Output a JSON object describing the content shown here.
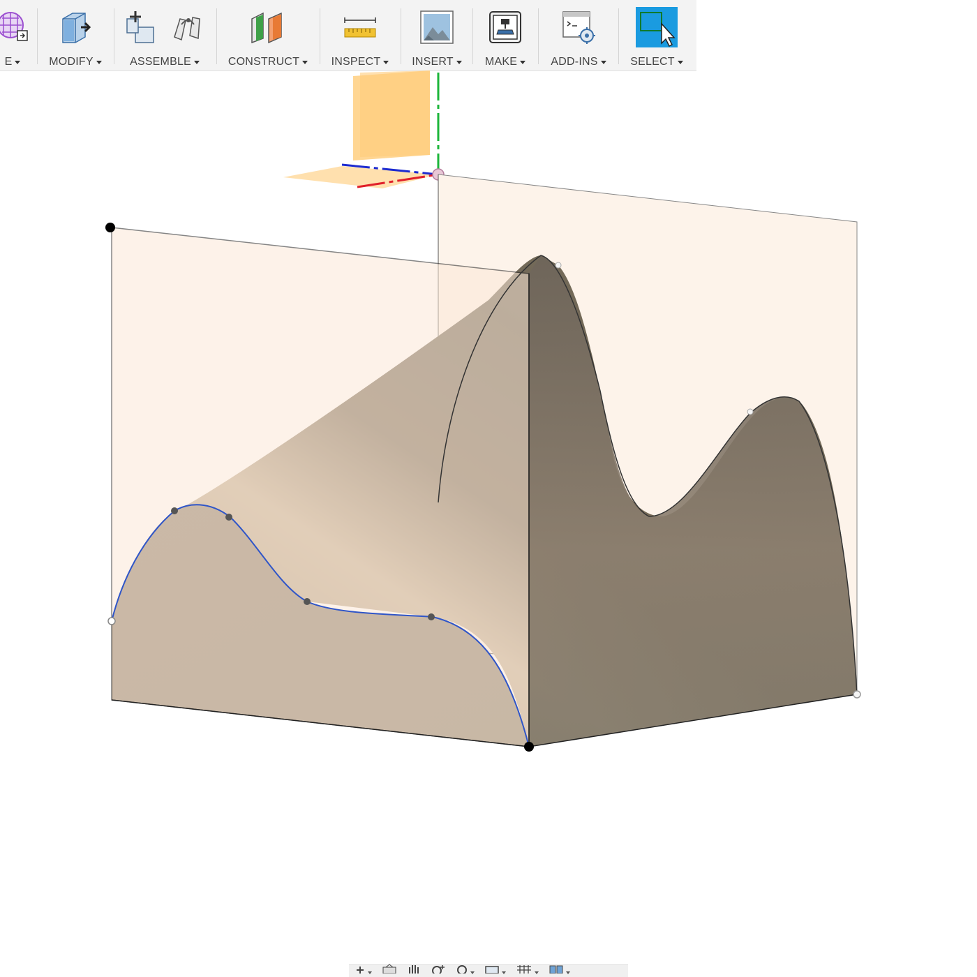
{
  "toolbar": {
    "groups": [
      {
        "label": "E",
        "icon": "create-form-icon"
      },
      {
        "label": "MODIFY",
        "icon": "modify-box-icon"
      },
      {
        "label": "ASSEMBLE",
        "icon": "new-component-icon"
      },
      {
        "label": "CONSTRUCT",
        "icon": "construct-plane-icon"
      },
      {
        "label": "INSPECT",
        "icon": "measure-ruler-icon"
      },
      {
        "label": "INSERT",
        "icon": "insert-image-icon"
      },
      {
        "label": "MAKE",
        "icon": "3d-print-icon"
      },
      {
        "label": "ADD-INS",
        "icon": "scripts-addins-icon"
      },
      {
        "label": "SELECT",
        "icon": "select-cursor-icon"
      }
    ],
    "accent_color": "#1a9be0"
  },
  "viewport": {
    "surface_color": "#8a7b68",
    "sketch_plane_color": "#fdf3ea",
    "origin_plane_color": "#ffcc7a",
    "curve_color": "#2f55c8",
    "axis_colors": {
      "x": "#e0202a",
      "y": "#1cb53a",
      "z": "#1c2bd0"
    }
  },
  "navigation_bar": {
    "items": [
      "orbit-icon",
      "look-at-icon",
      "pan-hand-icon",
      "zoom-icon",
      "zoom-window-icon",
      "display-settings-icon",
      "grid-icon",
      "viewports-icon"
    ]
  }
}
